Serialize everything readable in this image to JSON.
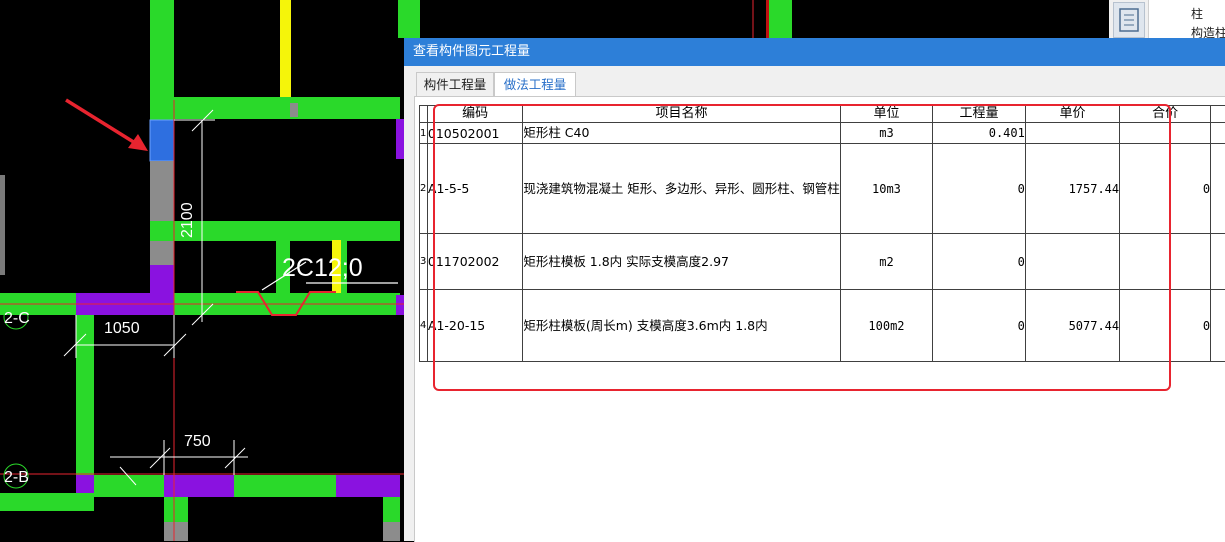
{
  "colors": {
    "green": "#2ad92a",
    "purple": "#8a12e0",
    "gray": "#8c8c8c",
    "blue": "#2e6fe0",
    "yellow": "#f5f50a",
    "red": "#e8242f",
    "accent": "#2d7fd8"
  },
  "cad": {
    "dims": {
      "d2100": "2100",
      "d1050": "1050",
      "d750": "750"
    },
    "axes": {
      "c": "2-C",
      "b": "2-B"
    },
    "rebar": "2C12;0"
  },
  "dialog": {
    "title": "查看构件图元工程量",
    "tabs": [
      {
        "label": "构件工程量"
      },
      {
        "label": "做法工程量"
      }
    ],
    "active_tab": 1,
    "columns": [
      "编码",
      "项目名称",
      "单位",
      "工程量",
      "单价",
      "合价"
    ],
    "rows": [
      {
        "no": "1",
        "code": "010502001",
        "name": "矩形柱 C40",
        "unit": "m3",
        "qty": "0.401",
        "price": "",
        "total": ""
      },
      {
        "no": "2",
        "code": "A1-5-5",
        "name": "现浇建筑物混凝土 矩形、多边形、异形、圆形柱、钢管柱",
        "unit": "10m3",
        "qty": "0",
        "price": "1757.44",
        "total": "0"
      },
      {
        "no": "3",
        "code": "011702002",
        "name": "矩形柱模板 1.8内 实际支模高度2.97",
        "unit": "m2",
        "qty": "0",
        "price": "",
        "total": ""
      },
      {
        "no": "4",
        "code": "A1-20-15",
        "name": "矩形柱模板(周长m) 支模高度3.6m内 1.8内",
        "unit": "100m2",
        "qty": "0",
        "price": "5077.44",
        "total": "0"
      }
    ]
  },
  "right_panel": {
    "items": [
      "柱",
      "构造柱"
    ],
    "icon": "component-list-icon"
  }
}
